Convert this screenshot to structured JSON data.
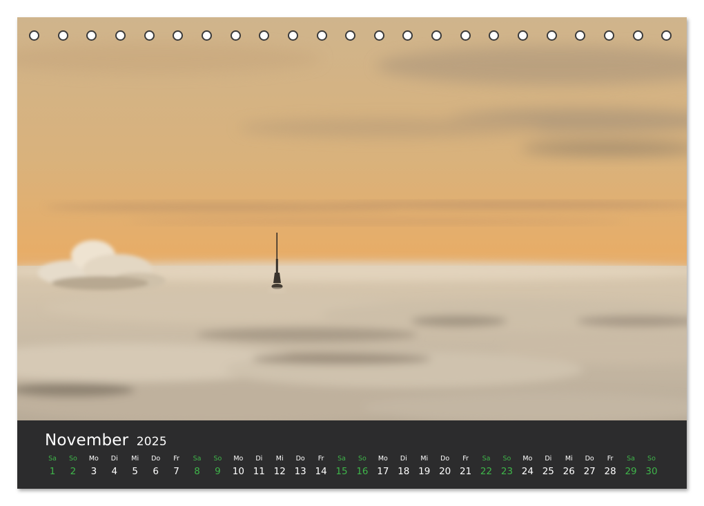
{
  "calendar": {
    "month": "November",
    "year": "2025",
    "days": [
      {
        "wd": "Sa",
        "d": "1",
        "weekend": true
      },
      {
        "wd": "So",
        "d": "2",
        "weekend": true
      },
      {
        "wd": "Mo",
        "d": "3",
        "weekend": false
      },
      {
        "wd": "Di",
        "d": "4",
        "weekend": false
      },
      {
        "wd": "Mi",
        "d": "5",
        "weekend": false
      },
      {
        "wd": "Do",
        "d": "6",
        "weekend": false
      },
      {
        "wd": "Fr",
        "d": "7",
        "weekend": false
      },
      {
        "wd": "Sa",
        "d": "8",
        "weekend": true
      },
      {
        "wd": "So",
        "d": "9",
        "weekend": true
      },
      {
        "wd": "Mo",
        "d": "10",
        "weekend": false
      },
      {
        "wd": "Di",
        "d": "11",
        "weekend": false
      },
      {
        "wd": "Mi",
        "d": "12",
        "weekend": false
      },
      {
        "wd": "Do",
        "d": "13",
        "weekend": false
      },
      {
        "wd": "Fr",
        "d": "14",
        "weekend": false
      },
      {
        "wd": "Sa",
        "d": "15",
        "weekend": true
      },
      {
        "wd": "So",
        "d": "16",
        "weekend": true
      },
      {
        "wd": "Mo",
        "d": "17",
        "weekend": false
      },
      {
        "wd": "Di",
        "d": "18",
        "weekend": false
      },
      {
        "wd": "Mi",
        "d": "19",
        "weekend": false
      },
      {
        "wd": "Do",
        "d": "20",
        "weekend": false
      },
      {
        "wd": "Fr",
        "d": "21",
        "weekend": false
      },
      {
        "wd": "Sa",
        "d": "22",
        "weekend": true
      },
      {
        "wd": "So",
        "d": "23",
        "weekend": true
      },
      {
        "wd": "Mo",
        "d": "24",
        "weekend": false
      },
      {
        "wd": "Di",
        "d": "25",
        "weekend": false
      },
      {
        "wd": "Mi",
        "d": "26",
        "weekend": false
      },
      {
        "wd": "Do",
        "d": "27",
        "weekend": false
      },
      {
        "wd": "Fr",
        "d": "28",
        "weekend": false
      },
      {
        "wd": "Sa",
        "d": "29",
        "weekend": true
      },
      {
        "wd": "So",
        "d": "30",
        "weekend": true
      }
    ]
  },
  "binding_holes": 23,
  "colors": {
    "band": "#2c2c2d",
    "weekend": "#3fb54a",
    "weekday": "#ffffff",
    "sky_top": "#d9b783",
    "sky_horizon": "#e8a75e",
    "fog": "#cbbfae"
  },
  "photo": {
    "subject": "tv-tower-above-fog-icon"
  }
}
